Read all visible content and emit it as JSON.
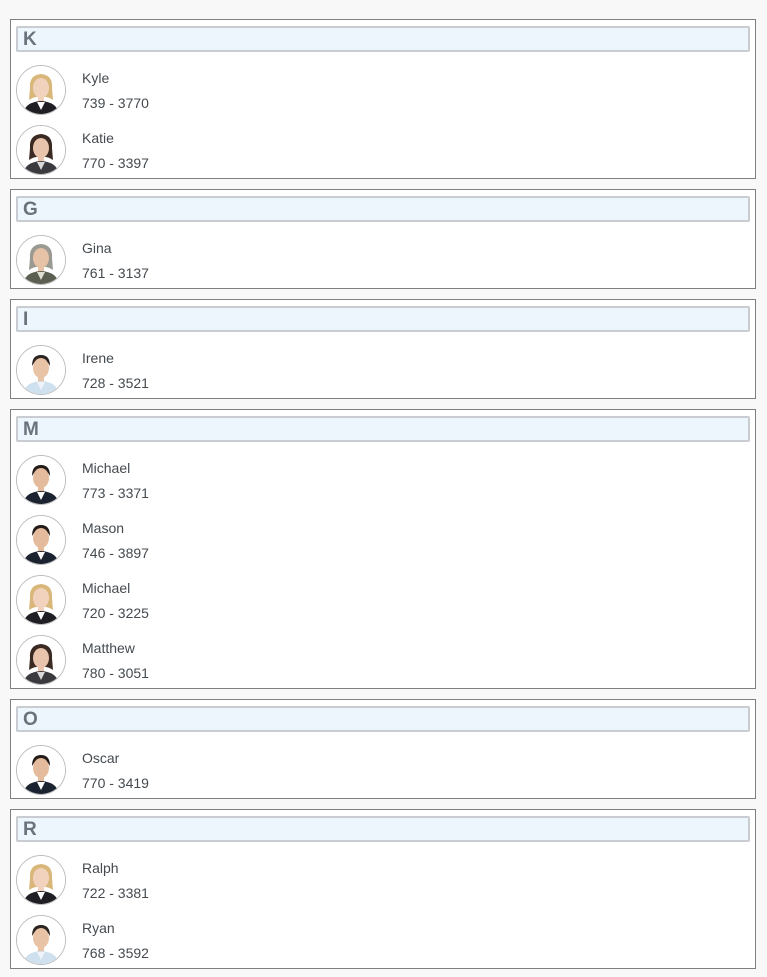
{
  "groups": [
    {
      "letter": "K",
      "contacts": [
        {
          "name": "Kyle",
          "phone": "739 - 3770",
          "avatar": "blonde-woman-photo"
        },
        {
          "name": "Katie",
          "phone": "770 - 3397",
          "avatar": "dark-haired-woman-photo"
        }
      ]
    },
    {
      "letter": "G",
      "contacts": [
        {
          "name": "Gina",
          "phone": "761 - 3137",
          "avatar": "gray-haired-woman-photo"
        }
      ]
    },
    {
      "letter": "I",
      "contacts": [
        {
          "name": "Irene",
          "phone": "728 - 3521",
          "avatar": "man-light-shirt-photo"
        }
      ]
    },
    {
      "letter": "M",
      "contacts": [
        {
          "name": "Michael",
          "phone": "773 - 3371",
          "avatar": "man-dark-suit-photo"
        },
        {
          "name": "Mason",
          "phone": "746 - 3897",
          "avatar": "man-dark-suit-photo"
        },
        {
          "name": "Michael",
          "phone": "720 - 3225",
          "avatar": "blonde-woman-photo"
        },
        {
          "name": "Matthew",
          "phone": "780 - 3051",
          "avatar": "dark-haired-woman-photo"
        }
      ]
    },
    {
      "letter": "O",
      "contacts": [
        {
          "name": "Oscar",
          "phone": "770 - 3419",
          "avatar": "man-dark-suit-photo"
        }
      ]
    },
    {
      "letter": "R",
      "contacts": [
        {
          "name": "Ralph",
          "phone": "722 - 3381",
          "avatar": "blonde-woman-photo"
        },
        {
          "name": "Ryan",
          "phone": "768 - 3592",
          "avatar": "man-light-shirt-photo"
        }
      ]
    }
  ]
}
